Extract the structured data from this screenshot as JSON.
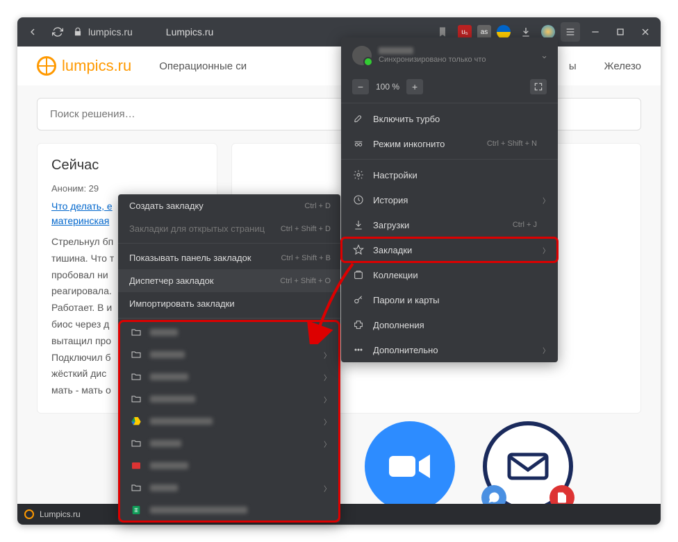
{
  "titlebar": {
    "url": "lumpics.ru",
    "tab_title": "Lumpics.ru"
  },
  "site": {
    "logo_text": "lumpics.ru",
    "nav1": "Операционные си",
    "nav2": "ы",
    "nav3": "Железо",
    "search_placeholder": "Поиск решения…"
  },
  "card": {
    "title": "Сейчас",
    "meta": "Аноним: 29",
    "link": "Что делать, е",
    "link2": "материнская",
    "body": "Стрельнул бп\nтишина. Что т\nпробовал ни\nреагировала.\nРаботает. В и\nбиос через д\nвытащил про\nПодключил б\nжёсткий дис\nмать - мать о"
  },
  "menu": {
    "sync_status": "Синхронизировано только что",
    "zoom_value": "100 %",
    "items": {
      "turbo": "Включить турбо",
      "incognito": "Режим инкогнито",
      "incognito_sc": "Ctrl + Shift + N",
      "settings": "Настройки",
      "history": "История",
      "downloads": "Загрузки",
      "downloads_sc": "Ctrl + J",
      "bookmarks": "Закладки",
      "collections": "Коллекции",
      "passwords": "Пароли и карты",
      "addons": "Дополнения",
      "more": "Дополнительно"
    }
  },
  "submenu": {
    "create": "Создать закладку",
    "create_sc": "Ctrl + D",
    "open_tabs": "Закладки для открытых страниц",
    "open_tabs_sc": "Ctrl + Shift + D",
    "show_bar": "Показывать панель закладок",
    "show_bar_sc": "Ctrl + Shift + B",
    "manager": "Диспетчер закладок",
    "manager_sc": "Ctrl + Shift + O",
    "import": "Импортировать закладки"
  },
  "taskbar": {
    "label": "Lumpics.ru"
  }
}
